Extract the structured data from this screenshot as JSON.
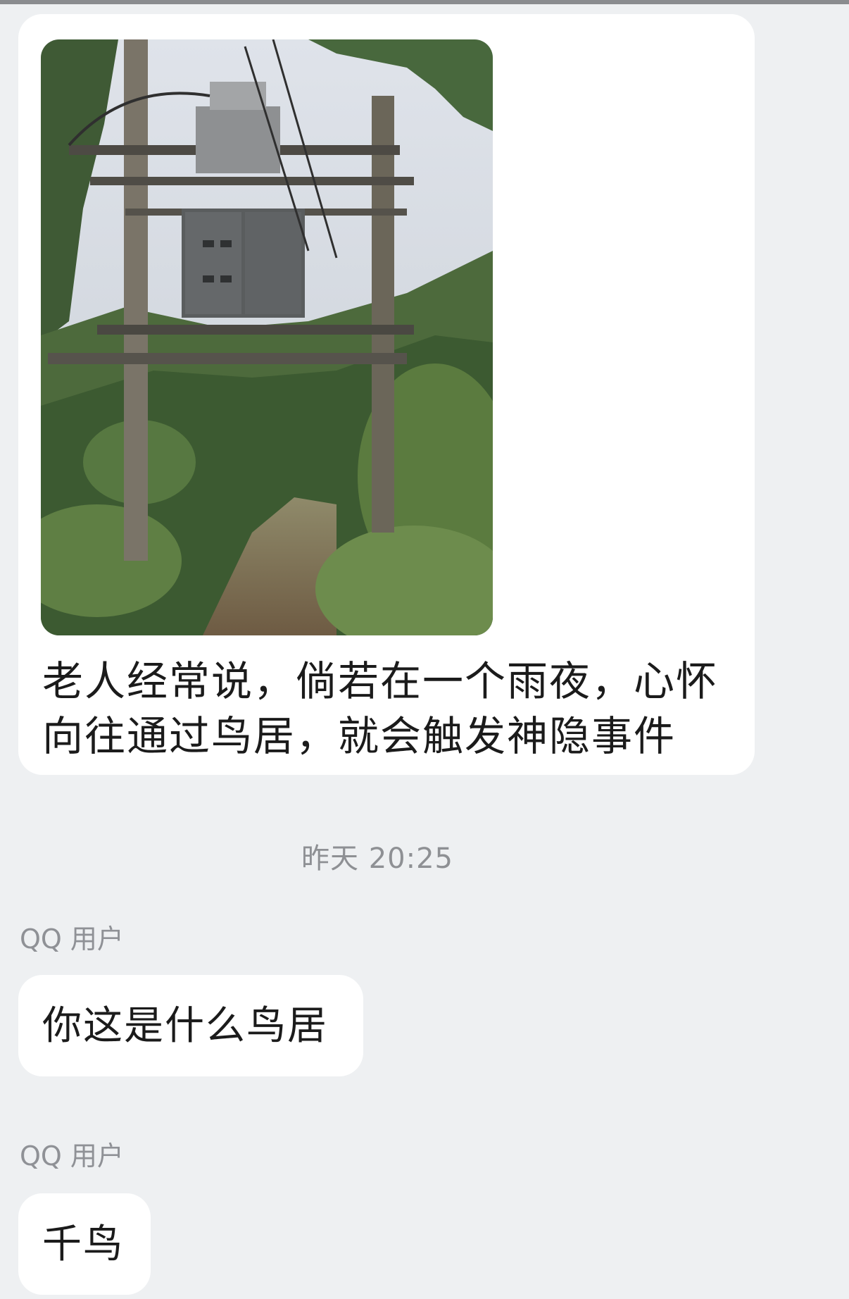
{
  "messages": [
    {
      "type": "image_with_caption",
      "image": "photo of a utility pole frame with transformer and electrical box above a forest path",
      "caption_line1": "老人经常说，倘若在一个雨夜，心怀",
      "caption_line2": "向往通过鸟居，就会触发神隐事件"
    }
  ],
  "timestamp": "昨天 20:25",
  "replies": [
    {
      "sender": "QQ 用户",
      "text": "你这是什么鸟居"
    },
    {
      "sender": "QQ 用户",
      "text": "千鸟"
    }
  ],
  "colors": {
    "background": "#eef0f2",
    "bubble": "#ffffff",
    "text": "#1b1b1b",
    "meta": "#8e9094"
  }
}
